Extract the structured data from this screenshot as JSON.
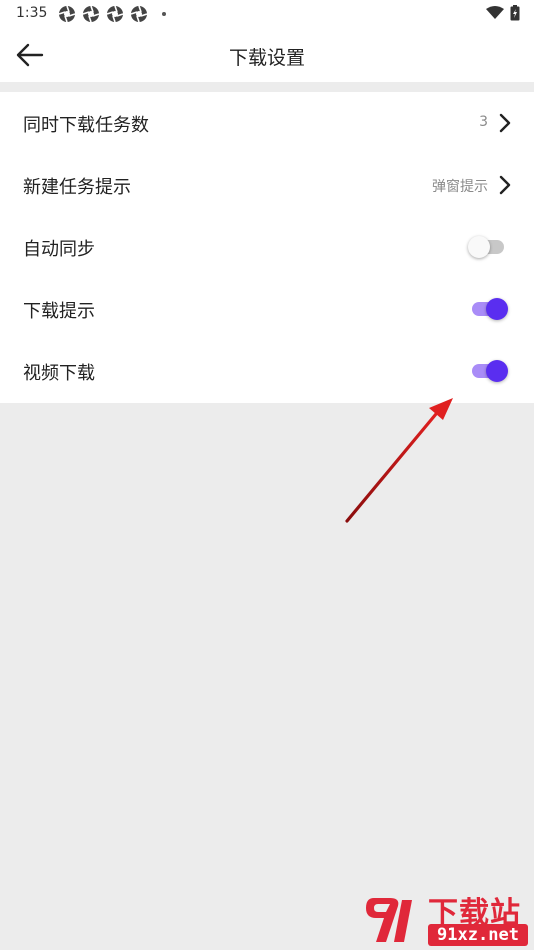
{
  "status_bar": {
    "time": "1:35",
    "notification_icons": [
      "aperture-icon",
      "aperture-icon",
      "aperture-icon",
      "aperture-icon"
    ],
    "right_icons": [
      "wifi-icon",
      "battery-charging-icon"
    ]
  },
  "app_bar": {
    "title": "下载设置",
    "back_icon": "arrow-left-icon"
  },
  "settings": [
    {
      "label": "同时下载任务数",
      "value": "3",
      "control": "chevron"
    },
    {
      "label": "新建任务提示",
      "value": "弹窗提示",
      "control": "chevron"
    },
    {
      "label": "自动同步",
      "control": "toggle",
      "checked": false
    },
    {
      "label": "下载提示",
      "control": "toggle",
      "checked": true
    },
    {
      "label": "视频下载",
      "control": "toggle",
      "checked": true
    }
  ],
  "annotation": {
    "type": "red-arrow",
    "points_to": "视频下载 toggle",
    "color": "#e02020"
  },
  "watermark": {
    "title": "下载站",
    "domain": "91xz.net",
    "color": "#e0283a"
  },
  "colors": {
    "accent": "#5a2ef0",
    "accent_track": "#a98cf7",
    "background": "#ececec",
    "surface": "#ffffff"
  }
}
